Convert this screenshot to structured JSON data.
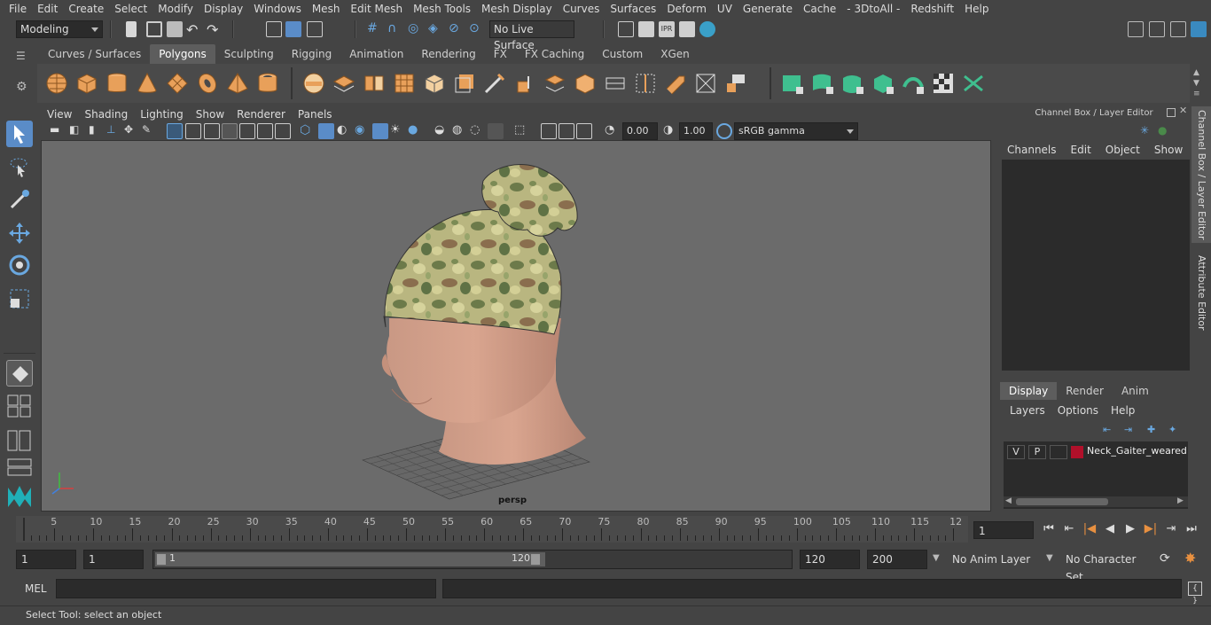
{
  "menu": [
    "File",
    "Edit",
    "Create",
    "Select",
    "Modify",
    "Display",
    "Windows",
    "Mesh",
    "Edit Mesh",
    "Mesh Tools",
    "Mesh Display",
    "Curves",
    "Surfaces",
    "Deform",
    "UV",
    "Generate",
    "Cache",
    "- 3DtoAll -",
    "Redshift",
    "Help"
  ],
  "status": {
    "mode": "Modeling",
    "live_surface": "No Live Surface"
  },
  "shelf_tabs": [
    "Curves / Surfaces",
    "Polygons",
    "Sculpting",
    "Rigging",
    "Animation",
    "Rendering",
    "FX",
    "FX Caching",
    "Custom",
    "XGen"
  ],
  "shelf_active_index": 1,
  "viewport": {
    "menu": [
      "View",
      "Shading",
      "Lighting",
      "Show",
      "Renderer",
      "Panels"
    ],
    "exposure": "0.00",
    "gamma": "1.00",
    "color_space": "sRGB gamma",
    "camera_label": "persp"
  },
  "channel_box": {
    "title": "Channel Box / Layer Editor",
    "menu": [
      "Channels",
      "Edit",
      "Object",
      "Show"
    ],
    "layer_tabs": [
      "Display",
      "Render",
      "Anim"
    ],
    "layer_menu": [
      "Layers",
      "Options",
      "Help"
    ],
    "layer": {
      "v": "V",
      "p": "P",
      "name": "Neck_Gaiter_weared_c",
      "color": "#b0102a"
    }
  },
  "side_tabs": [
    "Channel Box / Layer Editor",
    "Attribute Editor"
  ],
  "timeline": {
    "ticks": [
      "5",
      "10",
      "15",
      "20",
      "25",
      "30",
      "35",
      "40",
      "45",
      "50",
      "55",
      "60",
      "65",
      "70",
      "75",
      "80",
      "85",
      "90",
      "95",
      "100",
      "105",
      "110",
      "115",
      "12"
    ],
    "start_label": "1",
    "current_frame": "1"
  },
  "range": {
    "start": "1",
    "playback_start": "1",
    "slider_start": "1",
    "slider_end": "120",
    "playback_end": "120",
    "end": "200",
    "anim_layer": "No Anim Layer",
    "char_set": "No Character Set"
  },
  "command": {
    "label": "MEL"
  },
  "help_line": "Select Tool: select an object",
  "colors": {
    "accent_blue": "#5aa0d0",
    "shelf_orange": "#e8a05a",
    "shelf_green": "#3fbf8f"
  }
}
